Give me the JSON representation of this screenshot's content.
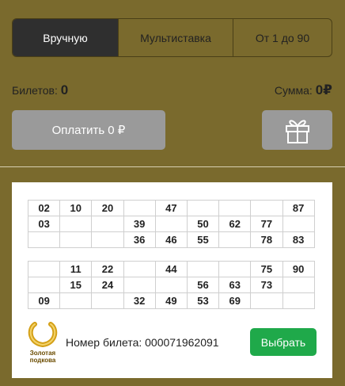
{
  "tabs": [
    {
      "label": "Вручную",
      "active": true
    },
    {
      "label": "Мультиставка",
      "active": false
    },
    {
      "label": "От 1 до 90",
      "active": false
    }
  ],
  "summary": {
    "tickets_label": "Билетов:",
    "tickets_value": "0",
    "sum_label": "Сумма:",
    "sum_value": "0₽"
  },
  "pay_button": {
    "label": "Оплатить 0 ₽"
  },
  "gift_button": {
    "icon": "gift-icon"
  },
  "ticket": {
    "grid_1": [
      [
        "02",
        "10",
        "20",
        "",
        "47",
        "",
        "",
        "",
        "87"
      ],
      [
        "03",
        "",
        "",
        "39",
        "",
        "50",
        "62",
        "77",
        ""
      ],
      [
        "",
        "",
        "",
        "36",
        "46",
        "55",
        "",
        "78",
        "83"
      ]
    ],
    "grid_2": [
      [
        "",
        "11",
        "22",
        "",
        "44",
        "",
        "",
        "75",
        "90"
      ],
      [
        "",
        "15",
        "24",
        "",
        "",
        "56",
        "63",
        "73",
        ""
      ],
      [
        "09",
        "",
        "",
        "32",
        "49",
        "53",
        "69",
        "",
        ""
      ]
    ],
    "logo_text_1": "Золотая",
    "logo_text_2": "подкова",
    "number_label": "Номер билета: 000071962091",
    "select_label": "Выбрать"
  },
  "colors": {
    "background": "#7a6a2d",
    "tab_active": "#2f2f2f",
    "button_gray": "#9a9a9a",
    "select_green": "#1fa94a"
  }
}
